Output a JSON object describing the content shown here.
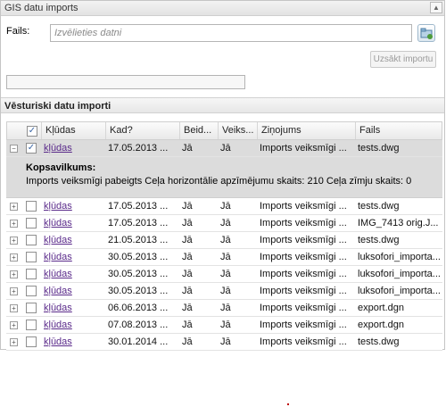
{
  "window": {
    "title": "GIS datu imports"
  },
  "file": {
    "label": "Fails:",
    "placeholder": "Izvēlieties datni"
  },
  "actions": {
    "start_label": "Uzsākt importu"
  },
  "history": {
    "title": "Vēsturiski datu importi"
  },
  "grid": {
    "columns": [
      "Kļūdas",
      "Kad?",
      "Beid...",
      "Veiks...",
      "Ziņojums",
      "Fails"
    ],
    "expanded_row": {
      "errors": "kļūdas",
      "when": "17.05.2013 ...",
      "finished": "Jā",
      "success": "Jā",
      "message": "Imports veiksmīgi ...",
      "file": "tests.dwg",
      "summary_title": "Kopsavilkums:",
      "summary_text": "Imports veiksmīgi pabeigts Ceļa horizontālie apzīmējumu skaits: 210 Ceļa zīmju skaits: 0"
    },
    "rows": [
      {
        "errors": "kļūdas",
        "when": "17.05.2013 ...",
        "finished": "Jā",
        "success": "Jā",
        "message": "Imports veiksmīgi ...",
        "file": "tests.dwg"
      },
      {
        "errors": "kļūdas",
        "when": "17.05.2013 ...",
        "finished": "Jā",
        "success": "Jā",
        "message": "Imports veiksmīgi ...",
        "file": "IMG_7413 orig.J..."
      },
      {
        "errors": "kļūdas",
        "when": "21.05.2013 ...",
        "finished": "Jā",
        "success": "Jā",
        "message": "Imports veiksmīgi ...",
        "file": "tests.dwg"
      },
      {
        "errors": "kļūdas",
        "when": "30.05.2013 ...",
        "finished": "Jā",
        "success": "Jā",
        "message": "Imports veiksmīgi ...",
        "file": "luksofori_importa..."
      },
      {
        "errors": "kļūdas",
        "when": "30.05.2013 ...",
        "finished": "Jā",
        "success": "Jā",
        "message": "Imports veiksmīgi ...",
        "file": "luksofori_importa..."
      },
      {
        "errors": "kļūdas",
        "when": "30.05.2013 ...",
        "finished": "Jā",
        "success": "Jā",
        "message": "Imports veiksmīgi ...",
        "file": "luksofori_importa..."
      },
      {
        "errors": "kļūdas",
        "when": "06.06.2013 ...",
        "finished": "Jā",
        "success": "Jā",
        "message": "Imports veiksmīgi ...",
        "file": "export.dgn"
      },
      {
        "errors": "kļūdas",
        "when": "07.08.2013 ...",
        "finished": "Jā",
        "success": "Jā",
        "message": "Imports veiksmīgi ...",
        "file": "export.dgn"
      },
      {
        "errors": "kļūdas",
        "when": "30.01.2014 ...",
        "finished": "Jā",
        "success": "Jā",
        "message": "Imports veiksmīgi ...",
        "file": "tests.dwg"
      }
    ]
  },
  "icons": {
    "browse": "folder-browse-icon",
    "expand": "plus-box-icon",
    "collapse": "minus-box-icon",
    "check": "checkmark-icon"
  },
  "colors": {
    "link": "#5a2a8a",
    "selected_row": "#dcdcdc",
    "header": "#e9e9e9"
  }
}
